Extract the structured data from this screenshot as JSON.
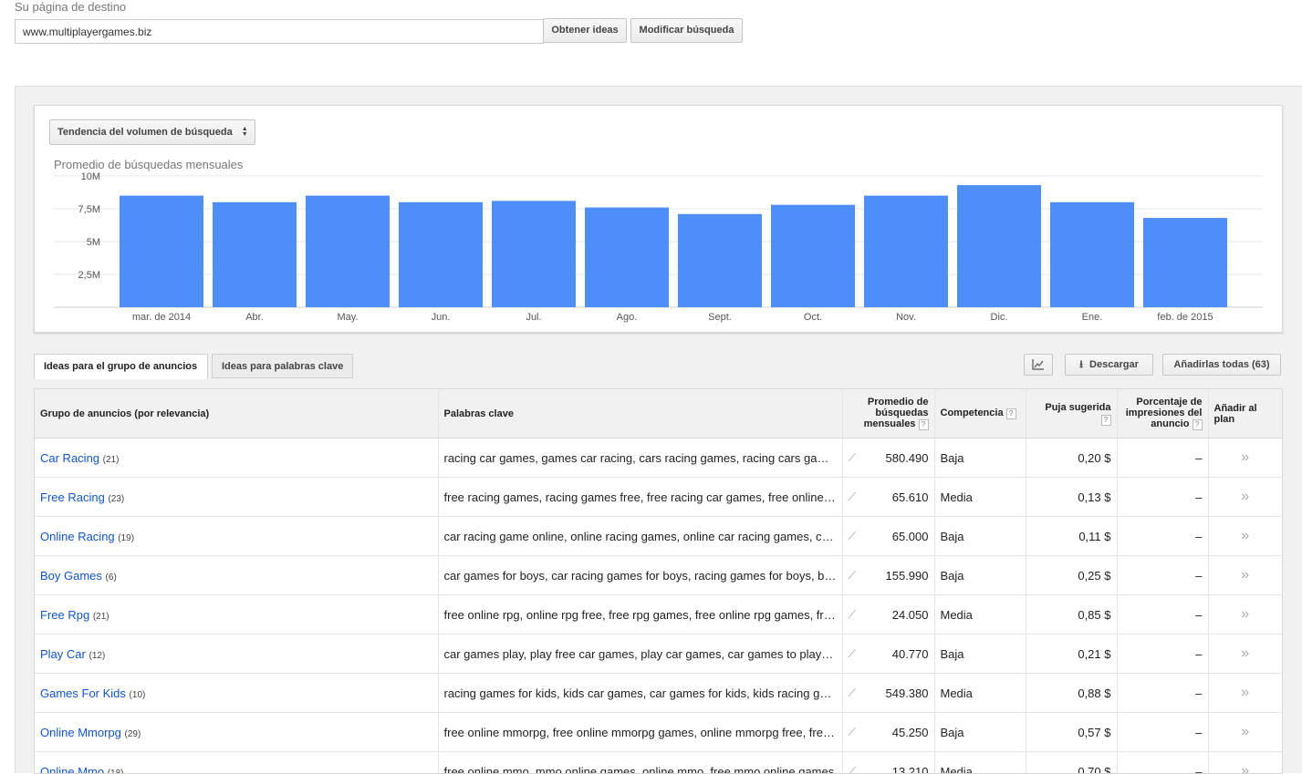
{
  "landing": {
    "label": "Su página de destino",
    "url": "www.multiplayergames.biz",
    "get_ideas": "Obtener ideas",
    "modify_search": "Modificar búsqueda"
  },
  "chart_panel": {
    "select_label": "Tendencia del volumen de búsqueda"
  },
  "chart_data": {
    "type": "bar",
    "title": "Promedio de búsquedas mensuales",
    "categories": [
      "mar. de 2014",
      "Abr.",
      "May.",
      "Jun.",
      "Jul.",
      "Ago.",
      "Sept.",
      "Oct.",
      "Nov.",
      "Dic.",
      "Ene.",
      "feb. de 2015"
    ],
    "values": [
      8500000,
      8000000,
      8500000,
      8000000,
      8100000,
      7600000,
      7100000,
      7800000,
      8500000,
      9300000,
      8000000,
      6800000
    ],
    "yticks": [
      "2,5M",
      "5M",
      "7,5M",
      "10M"
    ],
    "ylim": [
      0,
      10000000
    ],
    "color": "#4d8ef8"
  },
  "tabs": [
    {
      "label": "Ideas para el grupo de anuncios",
      "active": true
    },
    {
      "label": "Ideas para palabras clave",
      "active": false
    }
  ],
  "toolbar": {
    "chart_icon": "chart-icon",
    "download_label": "Descargar",
    "add_all_label": "Añadirlas todas (63)"
  },
  "table": {
    "headers": {
      "group": "Grupo de anuncios (por relevancia)",
      "keywords": "Palabras clave",
      "avg_searches": "Promedio de búsquedas mensuales",
      "competition": "Competencia",
      "bid": "Puja sugerida",
      "impressions": "Porcentaje de impresiones del anuncio",
      "add": "Añadir al plan"
    },
    "rows": [
      {
        "group": "Car Racing",
        "count": "(21)",
        "keywords": "racing car games, games car racing, cars racing games, racing cars games, car racing games",
        "searches": "580.490",
        "competition": "Baja",
        "bid": "0,20 $",
        "impr": "–"
      },
      {
        "group": "Free Racing",
        "count": "(23)",
        "keywords": "free racing games, racing games free, free racing car games, free online racing games",
        "searches": "65.610",
        "competition": "Media",
        "bid": "0,13 $",
        "impr": "–"
      },
      {
        "group": "Online Racing",
        "count": "(19)",
        "keywords": "car racing game online, online racing games, online car racing games, car racing online",
        "searches": "65.000",
        "competition": "Baja",
        "bid": "0,11 $",
        "impr": "–"
      },
      {
        "group": "Boy Games",
        "count": "(6)",
        "keywords": "car games for boys, car racing games for boys, racing games for boys, boys games",
        "searches": "155.990",
        "competition": "Baja",
        "bid": "0,25 $",
        "impr": "–"
      },
      {
        "group": "Free Rpg",
        "count": "(21)",
        "keywords": "free online rpg, online rpg free, free rpg games, free online rpg games, free rpg online",
        "searches": "24.050",
        "competition": "Media",
        "bid": "0,85 $",
        "impr": "–"
      },
      {
        "group": "Play Car",
        "count": "(12)",
        "keywords": "car games play, play free car games, play car games, car games to play online",
        "searches": "40.770",
        "competition": "Baja",
        "bid": "0,21 $",
        "impr": "–"
      },
      {
        "group": "Games For Kids",
        "count": "(10)",
        "keywords": "racing games for kids, kids car games, car games for kids, kids racing games",
        "searches": "549.380",
        "competition": "Media",
        "bid": "0,88 $",
        "impr": "–"
      },
      {
        "group": "Online Mmorpg",
        "count": "(29)",
        "keywords": "free online mmorpg, free online mmorpg games, online mmorpg free, free mmorpg online",
        "searches": "45.250",
        "competition": "Baja",
        "bid": "0,57 $",
        "impr": "–"
      },
      {
        "group": "Online Mmo",
        "count": "(18)",
        "keywords": "free online mmo, mmo online games, online mmo, free mmo online games",
        "searches": "13.210",
        "competition": "Media",
        "bid": "0,70 $",
        "impr": "–"
      }
    ]
  }
}
